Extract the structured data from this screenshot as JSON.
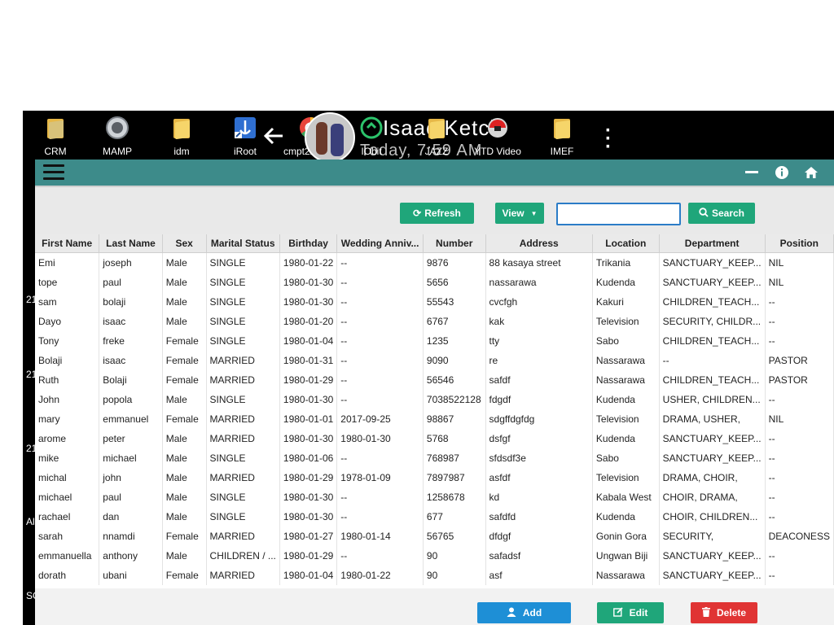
{
  "desktop": {
    "icons": [
      {
        "label": "CRM",
        "icon": "crm-shortcut-icon"
      },
      {
        "label": "MAMP",
        "icon": "mamp-icon"
      },
      {
        "label": "idm",
        "icon": "folder-icon"
      },
      {
        "label": "iRoot",
        "icon": "iroot-shortcut-icon"
      },
      {
        "label": "cmpt225 4...",
        "icon": "chrome-shortcut-icon"
      },
      {
        "label": "IObit",
        "icon": "iobit-icon"
      },
      {
        "label": "JAZZ",
        "icon": "folder-icon"
      },
      {
        "label": "YTD Video",
        "icon": "ytd-video-icon"
      },
      {
        "label": "IMEF",
        "icon": "folder-icon"
      }
    ],
    "overlay_title": "Isaac Ketch",
    "overlay_subtitle": "Today, 7:59 AM",
    "side_labels": [
      "21",
      "21",
      "21",
      "Al",
      "SC"
    ]
  },
  "app": {
    "header_icons": [
      "minimize-icon",
      "info-icon",
      "home-icon"
    ],
    "toolbar": {
      "refresh_label": "Refresh",
      "view_label": "View",
      "search_value": "",
      "search_label": "Search"
    },
    "table": {
      "columns": [
        "First Name",
        "Last Name",
        "Sex",
        "Marital Status",
        "Birthday",
        "Wedding Anniv...",
        "Number",
        "Address",
        "Location",
        "Department",
        "Position"
      ],
      "rows": [
        [
          "Emi",
          "joseph",
          "Male",
          "SINGLE",
          "1980-01-22",
          "--",
          "9876",
          "88 kasaya street",
          "Trikania",
          "SANCTUARY_KEEP...",
          "NIL"
        ],
        [
          "tope",
          "paul",
          "Male",
          "SINGLE",
          "1980-01-30",
          "--",
          "5656",
          "nassarawa",
          "Kudenda",
          "SANCTUARY_KEEP...",
          "NIL"
        ],
        [
          "sam",
          "bolaji",
          "Male",
          "SINGLE",
          "1980-01-30",
          "--",
          "55543",
          "cvcfgh",
          "Kakuri",
          "CHILDREN_TEACH...",
          "--"
        ],
        [
          "Dayo",
          "isaac",
          "Male",
          "SINGLE",
          "1980-01-20",
          "--",
          "6767",
          "kak",
          "Television",
          "SECURITY, CHILDR...",
          "--"
        ],
        [
          "Tony",
          "freke",
          "Female",
          "SINGLE",
          "1980-01-04",
          "--",
          "1235",
          "tty",
          "Sabo",
          "CHILDREN_TEACH...",
          "--"
        ],
        [
          "Bolaji",
          "isaac",
          "Female",
          "MARRIED",
          "1980-01-31",
          "--",
          "9090",
          "re",
          "Nassarawa",
          "--",
          "PASTOR"
        ],
        [
          "Ruth",
          "Bolaji",
          "Female",
          "MARRIED",
          "1980-01-29",
          "--",
          "56546",
          "safdf",
          "Nassarawa",
          "CHILDREN_TEACH...",
          "PASTOR"
        ],
        [
          "John",
          "popola",
          "Male",
          "SINGLE",
          "1980-01-30",
          "--",
          "7038522128",
          "fdgdf",
          "Kudenda",
          "USHER, CHILDREN...",
          "--"
        ],
        [
          "mary",
          "emmanuel",
          "Female",
          "MARRIED",
          "1980-01-01",
          "2017-09-25",
          "98867",
          "sdgffdgfdg",
          "Television",
          "DRAMA, USHER,",
          "NIL"
        ],
        [
          "arome",
          "peter",
          "Male",
          "MARRIED",
          "1980-01-30",
          "1980-01-30",
          "5768",
          "dsfgf",
          "Kudenda",
          "SANCTUARY_KEEP...",
          "--"
        ],
        [
          "mike",
          "michael",
          "Male",
          "SINGLE",
          "1980-01-06",
          "--",
          "768987",
          "sfdsdf3e",
          "Sabo",
          "SANCTUARY_KEEP...",
          "--"
        ],
        [
          "michal",
          "john",
          "Male",
          "MARRIED",
          "1980-01-29",
          "1978-01-09",
          "7897987",
          "asfdf",
          "Television",
          "DRAMA, CHOIR,",
          "--"
        ],
        [
          "michael",
          "paul",
          "Male",
          "SINGLE",
          "1980-01-30",
          "--",
          "1258678",
          "kd",
          "Kabala West",
          "CHOIR, DRAMA,",
          "--"
        ],
        [
          "rachael",
          "dan",
          "Male",
          "SINGLE",
          "1980-01-30",
          "--",
          "677",
          "safdfd",
          "Kudenda",
          "CHOIR, CHILDREN...",
          "--"
        ],
        [
          "sarah",
          "nnamdi",
          "Female",
          "MARRIED",
          "1980-01-27",
          "1980-01-14",
          "56765",
          "dfdgf",
          "Gonin Gora",
          "SECURITY,",
          "DEACONESS"
        ],
        [
          "emmanuella",
          "anthony",
          "Male",
          "CHILDREN / ...",
          "1980-01-29",
          "--",
          "90",
          "safadsf",
          "Ungwan Biji",
          "SANCTUARY_KEEP...",
          "--"
        ],
        [
          "dorath",
          "ubani",
          "Female",
          "MARRIED",
          "1980-01-04",
          "1980-01-22",
          "90",
          "asf",
          "Nassarawa",
          "SANCTUARY_KEEP...",
          "--"
        ]
      ]
    },
    "footer": {
      "add_label": "Add",
      "edit_label": "Edit",
      "delete_label": "Delete"
    },
    "colors": {
      "header": "#3d8b8a",
      "green_button": "#1fa67a",
      "add_button": "#1e8fd6",
      "edit_button": "#1fa67a",
      "delete_button": "#e03434"
    }
  }
}
